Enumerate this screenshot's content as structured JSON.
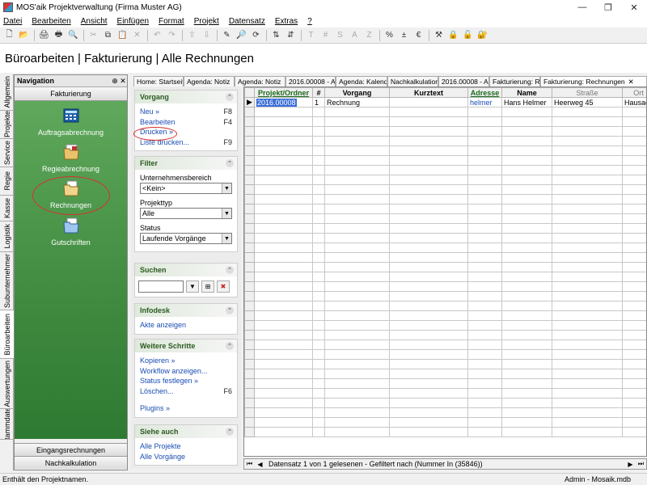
{
  "window": {
    "title": "MOS'aik Projektverwaltung (Firma Muster AG)"
  },
  "menu": [
    "Datei",
    "Bearbeiten",
    "Ansicht",
    "Einfügen",
    "Format",
    "Projekt",
    "Datensatz",
    "Extras",
    "?"
  ],
  "toolbar": {
    "buttons": [
      {
        "name": "new-icon",
        "glyph": "🗋"
      },
      {
        "name": "open-icon",
        "glyph": "📂"
      },
      {
        "sep": true
      },
      {
        "name": "print-preview-icon",
        "glyph": "🖨"
      },
      {
        "name": "print-icon",
        "glyph": "🖶"
      },
      {
        "name": "preview-icon",
        "glyph": "🔍"
      },
      {
        "sep": true
      },
      {
        "name": "cut-icon",
        "glyph": "✂",
        "disabled": true
      },
      {
        "name": "copy-icon",
        "glyph": "⧉"
      },
      {
        "name": "paste-icon",
        "glyph": "📋",
        "disabled": true
      },
      {
        "name": "delete-icon",
        "glyph": "✕",
        "disabled": true
      },
      {
        "sep": true
      },
      {
        "name": "undo-icon",
        "glyph": "↶",
        "disabled": true
      },
      {
        "name": "redo-icon",
        "glyph": "↷",
        "disabled": true
      },
      {
        "sep": true
      },
      {
        "name": "arrow-up-icon",
        "glyph": "⇧",
        "disabled": true
      },
      {
        "name": "arrow-down-icon",
        "glyph": "⇩",
        "disabled": true
      },
      {
        "sep": true
      },
      {
        "name": "pen-icon",
        "glyph": "✎"
      },
      {
        "name": "find-icon",
        "glyph": "🔎"
      },
      {
        "name": "refresh-icon",
        "glyph": "⟳"
      },
      {
        "sep": true
      },
      {
        "name": "sort-az-icon",
        "glyph": "⇅"
      },
      {
        "name": "sort-za-icon",
        "glyph": "⇵"
      },
      {
        "sep": true
      },
      {
        "name": "text-icon",
        "glyph": "T",
        "disabled": true
      },
      {
        "name": "hash-icon",
        "glyph": "#",
        "disabled": true
      },
      {
        "name": "s-icon",
        "glyph": "S",
        "disabled": true
      },
      {
        "name": "a-icon",
        "glyph": "A",
        "disabled": true
      },
      {
        "name": "z-icon",
        "glyph": "Z",
        "disabled": true
      },
      {
        "sep": true
      },
      {
        "name": "percent-icon",
        "glyph": "%"
      },
      {
        "name": "decimal-icon",
        "glyph": "±"
      },
      {
        "name": "euro-icon",
        "glyph": "€"
      },
      {
        "sep": true
      },
      {
        "name": "tools-icon",
        "glyph": "⚒"
      },
      {
        "name": "lock-blue-icon",
        "glyph": "🔒"
      },
      {
        "name": "lock-yellow-icon",
        "glyph": "🔓"
      },
      {
        "name": "lock-red-icon",
        "glyph": "🔐"
      }
    ]
  },
  "page_title": "Büroarbeiten | Fakturierung | Alle Rechnungen",
  "vertical_tabs": [
    "Allgemein",
    "Projekte",
    "Service",
    "Regie",
    "Kasse",
    "Logistik",
    "Subunternehmer",
    "Büroarbeiten",
    "Auswertungen",
    "Stammdaten"
  ],
  "navigation": {
    "title": "Navigation",
    "pin": "⊕",
    "close": "✕",
    "section": "Fakturierung",
    "items": [
      {
        "label": "Auftragsabrechnung",
        "icon": "calculator-icon"
      },
      {
        "label": "Regieabrechnung",
        "icon": "folder-stack-icon"
      },
      {
        "label": "Rechnungen",
        "icon": "folder-icon"
      },
      {
        "label": "Gutschriften",
        "icon": "folder-blue-icon"
      }
    ],
    "bottom": [
      "Eingangsrechnungen",
      "Nachkalkulation"
    ]
  },
  "taskpane": {
    "vorgang": {
      "title": "Vorgang",
      "links": [
        {
          "label": "Neu »",
          "key": "F8"
        },
        {
          "label": "Bearbeiten",
          "key": "F4"
        },
        {
          "label": "Drucken »",
          "key": ""
        },
        {
          "label": "Liste drucken...",
          "key": "F9"
        }
      ]
    },
    "filter": {
      "title": "Filter",
      "fields": [
        {
          "label": "Unternehmensbereich",
          "value": "<Kein>"
        },
        {
          "label": "Projekttyp",
          "value": "Alle"
        },
        {
          "label": "Status",
          "value": "Laufende Vorgänge"
        }
      ]
    },
    "suchen": {
      "title": "Suchen",
      "value": ""
    },
    "infodesk": {
      "title": "Infodesk",
      "links": [
        {
          "label": "Akte anzeigen",
          "key": ""
        }
      ]
    },
    "weitere": {
      "title": "Weitere Schritte",
      "links": [
        {
          "label": "Kopieren »",
          "key": ""
        },
        {
          "label": "Workflow anzeigen...",
          "key": ""
        },
        {
          "label": "Status festlegen »",
          "key": ""
        },
        {
          "label": "Löschen...",
          "key": "F6"
        }
      ],
      "extra": "Plugins »"
    },
    "siehe": {
      "title": "Siehe auch",
      "links": [
        {
          "label": "Alle Projekte",
          "key": ""
        },
        {
          "label": "Alle Vorgänge",
          "key": ""
        }
      ]
    }
  },
  "doc_tabs": [
    {
      "label": "Home: Startseite",
      "w": 62
    },
    {
      "label": "Agenda: Notiz",
      "w": 63
    },
    {
      "label": "Agenda: Notiz",
      "w": 63
    },
    {
      "label": "2016.00008 - A",
      "w": 62
    },
    {
      "label": "Agenda: Kalender",
      "w": 64
    },
    {
      "label": "Nachkalkulation",
      "w": 63
    },
    {
      "label": "2016.00008 - A",
      "w": 63
    },
    {
      "label": "Fakturierung: R",
      "w": 63
    },
    {
      "label": "Fakturierung: Rechnungen",
      "w": 132,
      "active": true,
      "closable": true
    }
  ],
  "grid": {
    "columns": [
      {
        "label": "",
        "w": 12
      },
      {
        "label": "Projekt/Ordner",
        "w": 72,
        "sorted": true
      },
      {
        "label": "#",
        "w": 15
      },
      {
        "label": "Vorgang",
        "w": 80
      },
      {
        "label": "Kurztext",
        "w": 97
      },
      {
        "label": "Adresse",
        "w": 42,
        "sorted": true
      },
      {
        "label": "Name",
        "w": 62
      },
      {
        "label": "Straße",
        "w": 87,
        "muted": true
      },
      {
        "label": "Ort",
        "w": 40,
        "muted": true
      }
    ],
    "rows": [
      [
        "2016.00008",
        "1",
        "Rechnung",
        "",
        "helmer",
        "Hans Helmer",
        "Heerweg 45",
        "Hausach"
      ]
    ],
    "empty_rows": 34
  },
  "record_nav": {
    "text": "Datensatz 1 von 1 gelesenen - Gefiltert nach (Nummer In (35846))",
    "first": "⏮",
    "prev": "◀",
    "next": "▶",
    "last": "⏭"
  },
  "status": {
    "left": "Enthält den Projektnamen.",
    "right": "Admin - Mosaik.mdb"
  },
  "colors": {
    "accent_red": "#d9302c",
    "nav_green": "#3f8a3f",
    "link_blue": "#1a4db3"
  }
}
